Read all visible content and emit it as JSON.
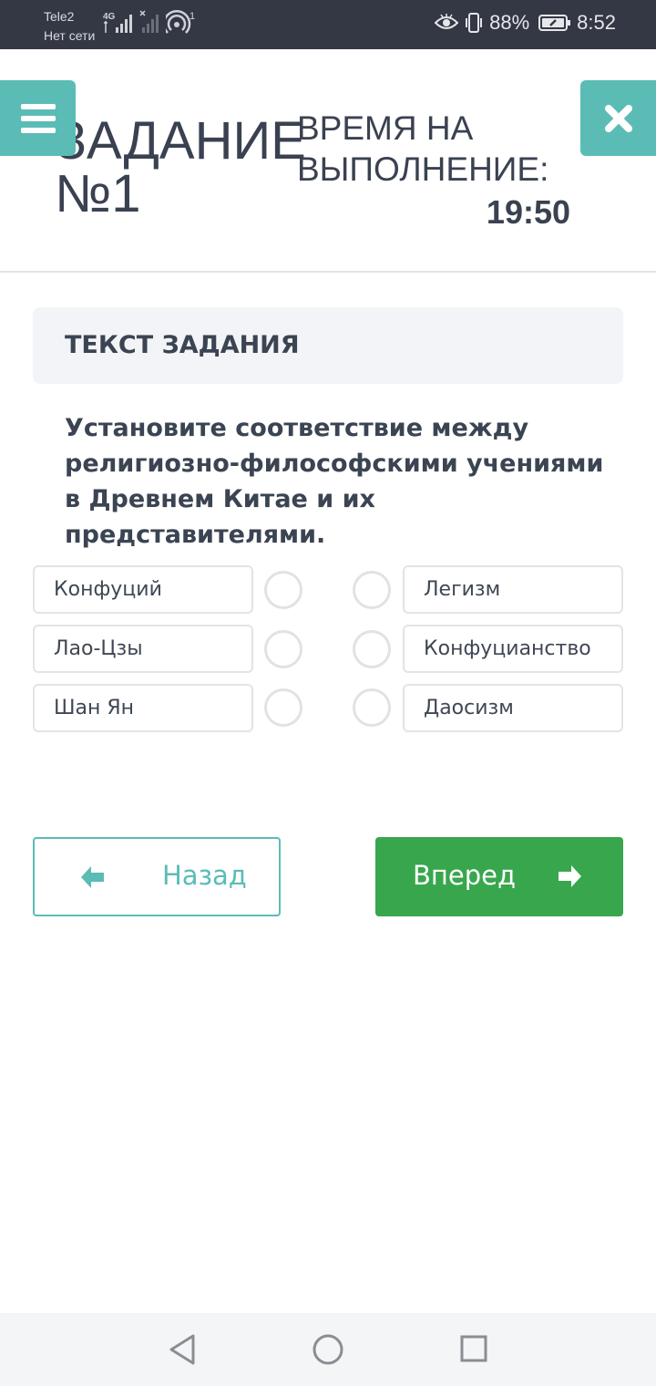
{
  "status_bar": {
    "carrier": "Tele2",
    "network_status": "Нет сети",
    "network_type": "4G",
    "hotspot_count": "1",
    "battery_percent": "88%",
    "time": "8:52",
    "icons": [
      "eye-icon",
      "vibrate-icon",
      "battery-icon",
      "signal-icon",
      "hotspot-icon"
    ]
  },
  "header": {
    "task_title": "ЗАДАНИЕ\n№1",
    "time_label": "ВРЕМЯ НА ВЫПОЛНЕНИЕ:",
    "timer": "19:50",
    "menu_icon": "hamburger-icon",
    "close_icon": "close-icon"
  },
  "task": {
    "section_label": "ТЕКСТ ЗАДАНИЯ",
    "question": "Установите соответствие между религиозно-философскими учениями в Древнем Китае и их представителями."
  },
  "matching": {
    "left": [
      "Конфуций",
      "Лао-Цзы",
      "Шан Ян"
    ],
    "right": [
      "Легизм",
      "Конфуцианство",
      "Даосизм"
    ]
  },
  "navigation": {
    "back_label": "Назад",
    "next_label": "Вперед"
  },
  "colors": {
    "accent_teal": "#5bbcb6",
    "next_green": "#38a64d",
    "status_bar": "#343845",
    "text_dark": "#3b4452"
  }
}
